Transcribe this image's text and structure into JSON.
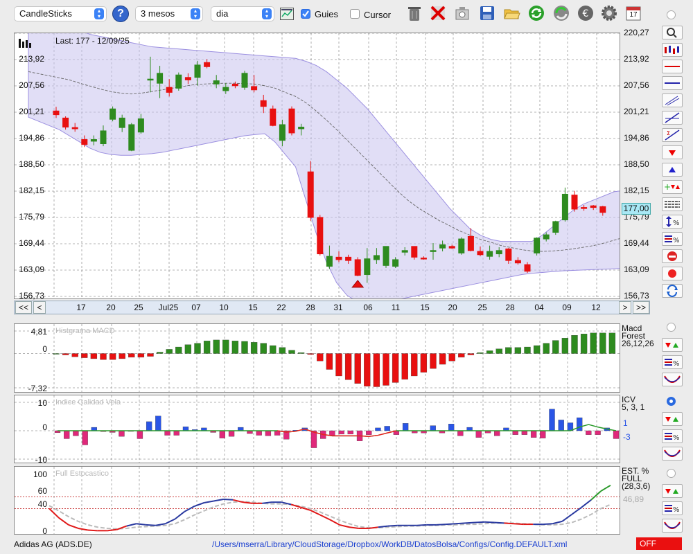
{
  "toolbar": {
    "chart_type": "CandleSticks",
    "period": "3 mesos",
    "interval": "dia",
    "guides_label": "Guies",
    "guides_checked": true,
    "cursor_label": "Cursor",
    "cursor_checked": false,
    "icons": [
      "help-icon",
      "chart-settings-icon",
      "trash-icon",
      "delete-icon",
      "export-icon",
      "save-icon",
      "open-folder-icon",
      "refresh-icon",
      "sync-icon",
      "currency-icon",
      "gear-icon",
      "calendar-icon"
    ],
    "calendar_day": "17"
  },
  "main_chart": {
    "last_label": "Last: 177 - 12/09/25",
    "price_badge": "177,00",
    "yticks": [
      "220,27",
      "213,92",
      "207,56",
      "201,21",
      "194,86",
      "188,50",
      "182,15",
      "175,79",
      "169,44",
      "163,09",
      "156,73"
    ],
    "xticks": [
      "17",
      "20",
      "25",
      "Jul25",
      "07",
      "10",
      "15",
      "22",
      "28",
      "31",
      "06",
      "11",
      "15",
      "20",
      "25",
      "28",
      "04",
      "09",
      "12"
    ],
    "nav": {
      "first": "<<",
      "prev": "<",
      "next": ">",
      "last": ">>"
    }
  },
  "macd_panel": {
    "title": "Histgrama MACD",
    "yticks": [
      "4,81",
      "0",
      "-7,32"
    ],
    "label_line1": "Macd",
    "label_line2": "Forest",
    "label_line3": "26,12,26"
  },
  "icv_panel": {
    "title": "Indice Calidad Vela",
    "yticks": [
      "10",
      "0",
      "-10"
    ],
    "label_line1": "ICV",
    "label_line2": "5, 3, 1",
    "value_pos": "1",
    "value_neg": "-3"
  },
  "stoch_panel": {
    "title": "Full Estocastico",
    "yticks": [
      "100",
      "60",
      "40",
      "0"
    ],
    "label_line1": "EST. %",
    "label_line2": "FULL",
    "label_line3": "(28,3,6)",
    "value": "46,89"
  },
  "footer": {
    "symbol": "Adidas AG (ADS.DE)",
    "config_path": "/Users/mserra/Library/CloudStorage/Dropbox/WorkDB/DatosBolsa/Configs/Config.DEFAULT.xml",
    "status": "OFF"
  },
  "colors": {
    "up": "#2e8b1f",
    "down": "#e81010",
    "band": "#c9c2ef",
    "macd_pos": "#2e8b1f",
    "macd_neg": "#e81010",
    "icv_pos": "#2a55e6",
    "icv_neg": "#e0287a",
    "status_bg": "#ea1010"
  },
  "chart_data": {
    "type": "candlestick",
    "ylim": [
      156.73,
      220.27
    ],
    "candles": [
      {
        "o": 201.5,
        "h": 202.5,
        "l": 199.8,
        "c": 200.6
      },
      {
        "o": 199.8,
        "h": 200.2,
        "l": 197.0,
        "c": 197.6
      },
      {
        "o": 197.5,
        "h": 198.6,
        "l": 196.5,
        "c": 197.2
      },
      {
        "o": 194.6,
        "h": 195.6,
        "l": 192.8,
        "c": 193.4
      },
      {
        "o": 194.2,
        "h": 195.6,
        "l": 193.2,
        "c": 194.6
      },
      {
        "o": 193.6,
        "h": 198.0,
        "l": 193.0,
        "c": 196.7
      },
      {
        "o": 199.5,
        "h": 202.6,
        "l": 199.0,
        "c": 202.0
      },
      {
        "o": 197.5,
        "h": 200.6,
        "l": 196.4,
        "c": 199.8
      },
      {
        "o": 192.0,
        "h": 198.6,
        "l": 191.8,
        "c": 198.2
      },
      {
        "o": 196.4,
        "h": 200.8,
        "l": 196.0,
        "c": 199.6
      },
      {
        "o": 209.0,
        "h": 214.6,
        "l": 206.0,
        "c": 209.2
      },
      {
        "o": 208.2,
        "h": 212.4,
        "l": 204.6,
        "c": 210.6
      },
      {
        "o": 207.2,
        "h": 209.2,
        "l": 205.0,
        "c": 206.0
      },
      {
        "o": 207.0,
        "h": 210.8,
        "l": 206.4,
        "c": 210.2
      },
      {
        "o": 209.6,
        "h": 210.6,
        "l": 208.0,
        "c": 209.0
      },
      {
        "o": 209.6,
        "h": 213.6,
        "l": 207.6,
        "c": 212.6
      },
      {
        "o": 213.2,
        "h": 214.0,
        "l": 211.8,
        "c": 212.2
      },
      {
        "o": 208.0,
        "h": 210.2,
        "l": 207.0,
        "c": 208.8
      },
      {
        "o": 206.4,
        "h": 208.2,
        "l": 205.6,
        "c": 207.2
      },
      {
        "o": 208.0,
        "h": 208.6,
        "l": 207.0,
        "c": 207.6
      },
      {
        "o": 207.2,
        "h": 211.2,
        "l": 206.6,
        "c": 210.6
      },
      {
        "o": 207.4,
        "h": 210.2,
        "l": 206.0,
        "c": 206.6
      },
      {
        "o": 204.0,
        "h": 205.4,
        "l": 201.0,
        "c": 202.6
      },
      {
        "o": 202.0,
        "h": 202.8,
        "l": 197.8,
        "c": 198.0
      },
      {
        "o": 194.4,
        "h": 199.4,
        "l": 193.0,
        "c": 198.2
      },
      {
        "o": 202.0,
        "h": 202.6,
        "l": 195.6,
        "c": 196.2
      },
      {
        "o": 197.2,
        "h": 198.4,
        "l": 195.6,
        "c": 197.6
      },
      {
        "o": 186.8,
        "h": 189.4,
        "l": 175.0,
        "c": 175.8
      },
      {
        "o": 175.8,
        "h": 176.4,
        "l": 166.6,
        "c": 167.0
      },
      {
        "o": 164.0,
        "h": 169.0,
        "l": 163.4,
        "c": 166.4
      },
      {
        "o": 166.2,
        "h": 167.6,
        "l": 165.0,
        "c": 165.6
      },
      {
        "o": 166.2,
        "h": 166.8,
        "l": 164.6,
        "c": 165.4
      },
      {
        "o": 165.6,
        "h": 166.2,
        "l": 161.6,
        "c": 161.8
      },
      {
        "o": 162.0,
        "h": 168.4,
        "l": 160.0,
        "c": 165.8
      },
      {
        "o": 165.6,
        "h": 168.4,
        "l": 164.6,
        "c": 166.6
      },
      {
        "o": 164.2,
        "h": 168.8,
        "l": 163.6,
        "c": 168.8
      },
      {
        "o": 164.0,
        "h": 166.2,
        "l": 163.6,
        "c": 165.6
      },
      {
        "o": 167.4,
        "h": 168.6,
        "l": 166.6,
        "c": 167.8
      },
      {
        "o": 168.8,
        "h": 168.8,
        "l": 165.6,
        "c": 166.2
      },
      {
        "o": 166.0,
        "h": 166.4,
        "l": 165.6,
        "c": 165.8
      },
      {
        "o": 167.6,
        "h": 169.6,
        "l": 165.6,
        "c": 167.8
      },
      {
        "o": 168.4,
        "h": 170.2,
        "l": 167.6,
        "c": 169.2
      },
      {
        "o": 168.8,
        "h": 169.2,
        "l": 168.2,
        "c": 168.4
      },
      {
        "o": 167.2,
        "h": 171.0,
        "l": 166.8,
        "c": 170.6
      },
      {
        "o": 171.2,
        "h": 173.2,
        "l": 167.6,
        "c": 167.8
      },
      {
        "o": 167.6,
        "h": 168.8,
        "l": 166.4,
        "c": 166.8
      },
      {
        "o": 166.4,
        "h": 169.0,
        "l": 165.6,
        "c": 167.6
      },
      {
        "o": 167.0,
        "h": 168.6,
        "l": 166.2,
        "c": 167.8
      },
      {
        "o": 168.2,
        "h": 168.4,
        "l": 164.6,
        "c": 165.4
      },
      {
        "o": 165.4,
        "h": 166.2,
        "l": 164.4,
        "c": 164.8
      },
      {
        "o": 164.4,
        "h": 165.0,
        "l": 162.4,
        "c": 162.8
      },
      {
        "o": 167.2,
        "h": 171.0,
        "l": 166.6,
        "c": 170.8
      },
      {
        "o": 170.6,
        "h": 172.2,
        "l": 170.0,
        "c": 171.6
      },
      {
        "o": 172.2,
        "h": 175.0,
        "l": 171.6,
        "c": 174.8
      },
      {
        "o": 175.2,
        "h": 183.0,
        "l": 174.8,
        "c": 181.4
      },
      {
        "o": 181.2,
        "h": 182.2,
        "l": 177.2,
        "c": 177.8
      },
      {
        "o": 178.2,
        "h": 178.8,
        "l": 177.4,
        "c": 178.0
      },
      {
        "o": 178.6,
        "h": 178.8,
        "l": 177.6,
        "c": 178.2
      },
      {
        "o": 178.4,
        "h": 178.6,
        "l": 176.2,
        "c": 177.0
      }
    ],
    "upper_band": [
      222,
      222,
      222,
      222,
      222,
      221,
      220,
      219.5,
      219,
      218.5,
      218,
      217.5,
      217,
      216.8,
      216.6,
      216.4,
      216.2,
      216,
      215.8,
      215.6,
      215.4,
      215.2,
      215,
      214.8,
      214.6,
      214.4,
      214.2,
      213.5,
      212.5,
      211,
      209,
      207,
      204.5,
      202,
      199,
      196,
      193,
      190,
      187,
      184,
      181,
      178,
      175.5,
      173,
      171.5,
      170.5,
      170,
      170,
      170,
      170,
      171.5,
      173.5,
      175.5,
      177.5,
      179,
      180,
      181,
      182,
      182.3
    ],
    "lower_band": [
      200,
      199,
      198,
      197,
      195.5,
      194,
      192.5,
      191.5,
      191,
      190.8,
      190.8,
      191,
      191.2,
      191.5,
      192,
      192.5,
      193,
      193.5,
      194,
      194.5,
      195,
      195.5,
      195.8,
      196,
      194,
      191,
      188,
      180,
      172,
      165,
      160,
      157,
      155.5,
      155,
      155,
      155.5,
      156,
      156.5,
      157,
      157.5,
      158,
      158.5,
      159,
      159.5,
      160,
      160.5,
      161,
      161.5,
      162,
      162.3,
      162.5,
      162.7,
      162.9,
      163.0,
      163.1,
      163.2,
      163.3,
      163.4,
      163.5
    ],
    "middle_line": [
      211,
      210.5,
      210,
      209.5,
      209,
      208.2,
      207.5,
      206.8,
      206.2,
      205.8,
      205.6,
      205.8,
      206.2,
      206.6,
      207,
      207.4,
      207.8,
      208,
      208.1,
      208.2,
      208.2,
      208.1,
      208,
      207.6,
      207,
      206,
      205,
      203.5,
      201.5,
      199.3,
      197,
      194.5,
      192,
      189.5,
      187,
      184.5,
      182,
      179.8,
      178,
      176.5,
      175,
      173.8,
      172.5,
      171.5,
      170.5,
      169.8,
      169,
      168.5,
      168,
      167.7,
      167.6,
      167.7,
      167.9,
      168.2,
      168.6,
      169,
      169.6,
      170.3,
      171.0
    ],
    "signal_marker_index": 32,
    "macd_histogram": [
      0,
      -0.3,
      -0.7,
      -0.9,
      -1.1,
      -1.3,
      -1.3,
      -1.1,
      -0.8,
      -0.8,
      -0.6,
      0.3,
      0.9,
      1.4,
      1.9,
      2.2,
      2.7,
      2.9,
      2.9,
      2.7,
      2.6,
      2.4,
      2.2,
      1.7,
      1.3,
      0.7,
      0.2,
      -0.2,
      -1.6,
      -3.4,
      -4.8,
      -5.6,
      -6.4,
      -7.0,
      -7.1,
      -6.8,
      -6.2,
      -5.5,
      -4.8,
      -4.0,
      -3.2,
      -2.3,
      -1.6,
      -0.8,
      -0.3,
      0.2,
      0.6,
      1.0,
      1.3,
      1.3,
      1.4,
      1.7,
      2.2,
      2.8,
      3.3,
      3.9,
      4.2,
      4.4,
      4.4,
      4.4
    ],
    "icv_bars": [
      -0.7,
      -2.8,
      -1.8,
      -5.0,
      1.2,
      -0.3,
      -0.6,
      -2.0,
      -0.2,
      -2.8,
      3.2,
      5.2,
      -1.6,
      -1.6,
      1.4,
      0.4,
      1.0,
      -0.6,
      -2.6,
      -2.0,
      1.2,
      -1.0,
      -1.6,
      -1.8,
      -1.6,
      -3.0,
      0.2,
      1.0,
      -6.0,
      -2.8,
      -1.6,
      -1.2,
      -1.2,
      -3.6,
      -1.4,
      1.0,
      1.6,
      -1.4,
      2.6,
      -0.8,
      -0.8,
      1.8,
      -0.8,
      2.4,
      -1.8,
      1.2,
      -2.4,
      -0.8,
      -1.8,
      1.0,
      -1.4,
      -1.4,
      -2.4,
      -2.6,
      7.6,
      3.8,
      2.8,
      4.6,
      -1.4,
      -1.4,
      1.0,
      -2.8
    ],
    "icv_signal": [
      0.0,
      0.0,
      0.0,
      0.0,
      0.0,
      0.0,
      0.0,
      0.0,
      0.0,
      0.0,
      0.0,
      0.0,
      0.0,
      0.0,
      0.0,
      0.0,
      0.0,
      0.0,
      0.0,
      0.0,
      0.0,
      0.0,
      0.0,
      0.0,
      0.0,
      -0.5,
      -0.2,
      0.6,
      -0.5,
      -1.3,
      -1.8,
      -1.8,
      -1.8,
      -1.8,
      -2.0,
      -1.6,
      -0.8,
      0.0,
      0.0,
      0.0,
      0.0,
      0.0,
      0.0,
      0.0,
      0.0,
      0.0,
      0.0,
      0.0,
      0.0,
      0.0,
      0.0,
      0.0,
      0.0,
      0.0,
      0.0,
      0.0,
      0.0,
      1.3,
      2.2,
      1.3,
      0.6,
      0.0
    ],
    "stoch_k": [
      40,
      24,
      12,
      6,
      3,
      2,
      2,
      4,
      10,
      14,
      12,
      11,
      14,
      22,
      35,
      44,
      50,
      53,
      56,
      55,
      51,
      49,
      49,
      51,
      51,
      47,
      42,
      37,
      29,
      21,
      12,
      8,
      6,
      6,
      8,
      10,
      11,
      11,
      11,
      12,
      12,
      13,
      14,
      15,
      16,
      17,
      16,
      15,
      14,
      13,
      13,
      13,
      14,
      18,
      30,
      42,
      55,
      70,
      80
    ],
    "stoch_d": [
      45,
      36,
      26,
      18,
      12,
      8,
      6,
      5,
      6,
      8,
      9,
      10,
      11,
      14,
      21,
      29,
      36,
      43,
      48,
      51,
      52,
      51,
      49,
      48,
      48,
      47,
      44,
      40,
      34,
      27,
      20,
      14,
      9,
      7,
      7,
      8,
      9,
      10,
      10,
      11,
      11,
      12,
      12,
      13,
      13,
      14,
      15,
      15,
      15,
      14,
      13,
      12,
      12,
      13,
      16,
      22,
      30,
      40,
      47
    ]
  }
}
